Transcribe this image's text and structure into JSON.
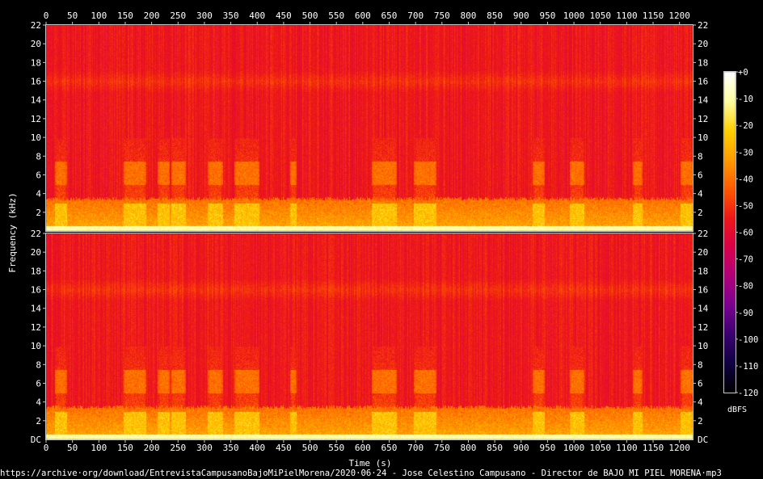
{
  "chart_data": {
    "type": "heatmap",
    "title": "",
    "xlabel": "Time (s)",
    "ylabel": "Frequency (kHz)",
    "source_caption": "https://archive·org/download/EntrevistaCampusanoBajoMiPielMorena/2020·06·24 - Jose Celestino Campusano - Director de BAJO MI PIEL MORENA·mp3",
    "x_ticks": [
      0,
      50,
      100,
      150,
      200,
      250,
      300,
      350,
      400,
      450,
      500,
      550,
      600,
      650,
      700,
      750,
      800,
      850,
      900,
      950,
      1000,
      1050,
      1100,
      1150,
      1200
    ],
    "xlim": [
      0,
      1225
    ],
    "y_ticks": [
      "22",
      "20",
      "18",
      "16",
      "14",
      "12",
      "10",
      "8",
      "6",
      "4",
      "2"
    ],
    "y_tick_values": [
      22,
      20,
      18,
      16,
      14,
      12,
      10,
      8,
      6,
      4,
      2
    ],
    "y_bottom_label": "DC",
    "ylim": [
      0,
      22
    ],
    "channels": 2,
    "colorbar": {
      "label": "dBFS",
      "ticks": [
        "+0",
        "-10",
        "-20",
        "-30",
        "-40",
        "-50",
        "-60",
        "-70",
        "-80",
        "-90",
        "-100",
        "-110",
        "-120"
      ],
      "range": [
        -120,
        0
      ],
      "colors": [
        "#000000",
        "#100040",
        "#3a0070",
        "#7a0090",
        "#b0007a",
        "#d8004a",
        "#ee1818",
        "#ff5a00",
        "#ff9c00",
        "#ffd200",
        "#ffffa0",
        "#ffffff"
      ]
    },
    "speech_segments_s": [
      [
        20,
        35
      ],
      [
        150,
        185
      ],
      [
        215,
        230
      ],
      [
        240,
        260
      ],
      [
        310,
        330
      ],
      [
        360,
        400
      ],
      [
        465,
        470
      ],
      [
        620,
        660
      ],
      [
        700,
        735
      ],
      [
        925,
        940
      ],
      [
        995,
        1015
      ],
      [
        1115,
        1125
      ],
      [
        1205,
        1225
      ]
    ],
    "levels_dbfs": {
      "background": -55,
      "band_16khz": -50,
      "low_band": -40,
      "speech_mid": -45,
      "speech_low": -25
    }
  }
}
